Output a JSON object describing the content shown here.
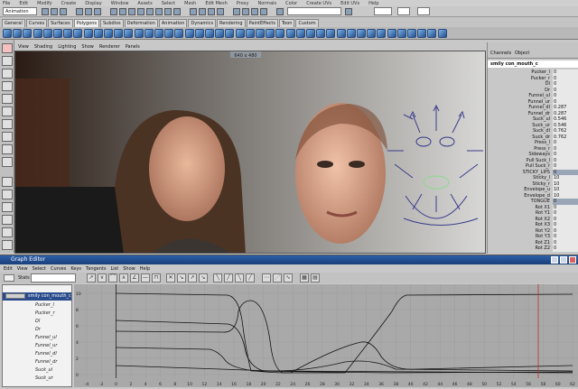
{
  "menubar": [
    "File",
    "Edit",
    "Modify",
    "Create",
    "Display",
    "Window",
    "Assets",
    "Select",
    "Mesh",
    "Edit Mesh",
    "Proxy",
    "Normals",
    "Color",
    "Create UVs",
    "Edit UVs",
    "Help"
  ],
  "statusline": {
    "mode": "Animation"
  },
  "shelf": {
    "tabs": [
      "General",
      "Curves",
      "Surfaces",
      "Polygons",
      "Subdivs",
      "Deformation",
      "Animation",
      "Dynamics",
      "Rendering",
      "PaintEffects",
      "Toon",
      "Custom"
    ],
    "active_tab": "Polygons"
  },
  "viewport": {
    "menu": [
      "View",
      "Shading",
      "Lighting",
      "Show",
      "Renderer",
      "Panels"
    ],
    "resolution": "640 x 480"
  },
  "channelbox": {
    "tabs": [
      "Channels",
      "Object"
    ],
    "object": "smily con_mouth_c",
    "channels": [
      {
        "name": "Pucker_l",
        "value": "0"
      },
      {
        "name": "Pucker_r",
        "value": "0"
      },
      {
        "name": "Dl",
        "value": "0"
      },
      {
        "name": "Dr",
        "value": "0"
      },
      {
        "name": "Funnel_ul",
        "value": "0"
      },
      {
        "name": "Funnel_ur",
        "value": "0"
      },
      {
        "name": "Funnel_dl",
        "value": "0.287"
      },
      {
        "name": "Funnel_dr",
        "value": "0.287"
      },
      {
        "name": "Suck_ul",
        "value": "0.546"
      },
      {
        "name": "Suck_ur",
        "value": "0.546"
      },
      {
        "name": "Suck_dl",
        "value": "0.762"
      },
      {
        "name": "Suck_dr",
        "value": "0.762"
      },
      {
        "name": "Press_l",
        "value": "0"
      },
      {
        "name": "Press_r",
        "value": "0"
      },
      {
        "name": "Sideways",
        "value": "0"
      },
      {
        "name": "Pull Suck_l",
        "value": "0"
      },
      {
        "name": "Pull Suck_r",
        "value": "0"
      },
      {
        "name": "STICKY_LIPS",
        "value": "0",
        "highlight": true
      },
      {
        "name": "Sticky_l",
        "value": "10"
      },
      {
        "name": "Sticky_r",
        "value": "10"
      },
      {
        "name": "Envelope_u",
        "value": "10"
      },
      {
        "name": "Envelope_d",
        "value": "10"
      },
      {
        "name": "TONGUE",
        "value": "0",
        "highlight": true
      },
      {
        "name": "Rot X1",
        "value": "0"
      },
      {
        "name": "Rot Y1",
        "value": "0"
      },
      {
        "name": "Rot X2",
        "value": "0"
      },
      {
        "name": "Rot X3",
        "value": "0"
      },
      {
        "name": "Rot Y2",
        "value": "0"
      },
      {
        "name": "Rot Y3",
        "value": "0"
      },
      {
        "name": "Rot Z1",
        "value": "0"
      },
      {
        "name": "Rot Z2",
        "value": "0"
      }
    ]
  },
  "graph_editor": {
    "title": "Graph Editor",
    "menu": [
      "Edit",
      "View",
      "Select",
      "Curves",
      "Keys",
      "Tangents",
      "List",
      "Show",
      "Help"
    ],
    "stats_label": "Stats",
    "outliner": {
      "root": "smily con_mouth_c",
      "items": [
        "Pucker_l",
        "Pucker_r",
        "Dl",
        "Dr",
        "Funnel_ul",
        "Funnel_ur",
        "Funnel_dl",
        "Funnel_dr",
        "Suck_ul",
        "Suck_ur"
      ]
    },
    "y_ticks": [
      "10",
      "8",
      "6",
      "4",
      "2",
      "0"
    ],
    "x_ticks": [
      "-4",
      "-2",
      "0",
      "2",
      "4",
      "6",
      "8",
      "10",
      "12",
      "14",
      "16",
      "18",
      "20",
      "22",
      "24",
      "26",
      "28",
      "30",
      "32",
      "34",
      "36",
      "38",
      "40",
      "42",
      "44",
      "46",
      "48",
      "50",
      "52",
      "54",
      "56",
      "58",
      "60",
      "62"
    ]
  }
}
